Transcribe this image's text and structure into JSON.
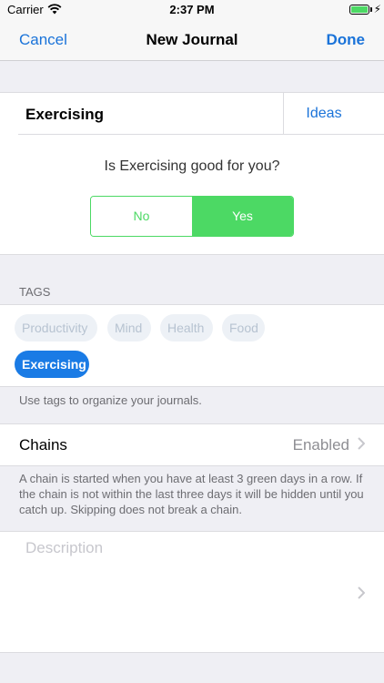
{
  "status": {
    "carrier": "Carrier",
    "time": "2:37 PM"
  },
  "nav": {
    "cancel": "Cancel",
    "title": "New Journal",
    "done": "Done"
  },
  "journal": {
    "name": "Exercising",
    "ideas": "Ideas",
    "question": "Is Exercising good for you?",
    "options": [
      "No",
      "Yes"
    ],
    "selected_option": "Yes"
  },
  "tags": {
    "header": "TAGS",
    "items": [
      "Productivity",
      "Mind",
      "Health",
      "Food",
      "Exercising"
    ],
    "selected": "Exercising",
    "footer": "Use tags to organize your journals."
  },
  "chains": {
    "label": "Chains",
    "value": "Enabled",
    "footer": "A chain is started when you have at least 3 green days in a row. If the chain is not within the last three days it will be hidden until you catch up. Skipping does not break a chain."
  },
  "description": {
    "placeholder": "Description",
    "value": ""
  },
  "colors": {
    "accent": "#1a73d9",
    "green": "#4cd964",
    "chip_selected": "#1a7be5"
  }
}
